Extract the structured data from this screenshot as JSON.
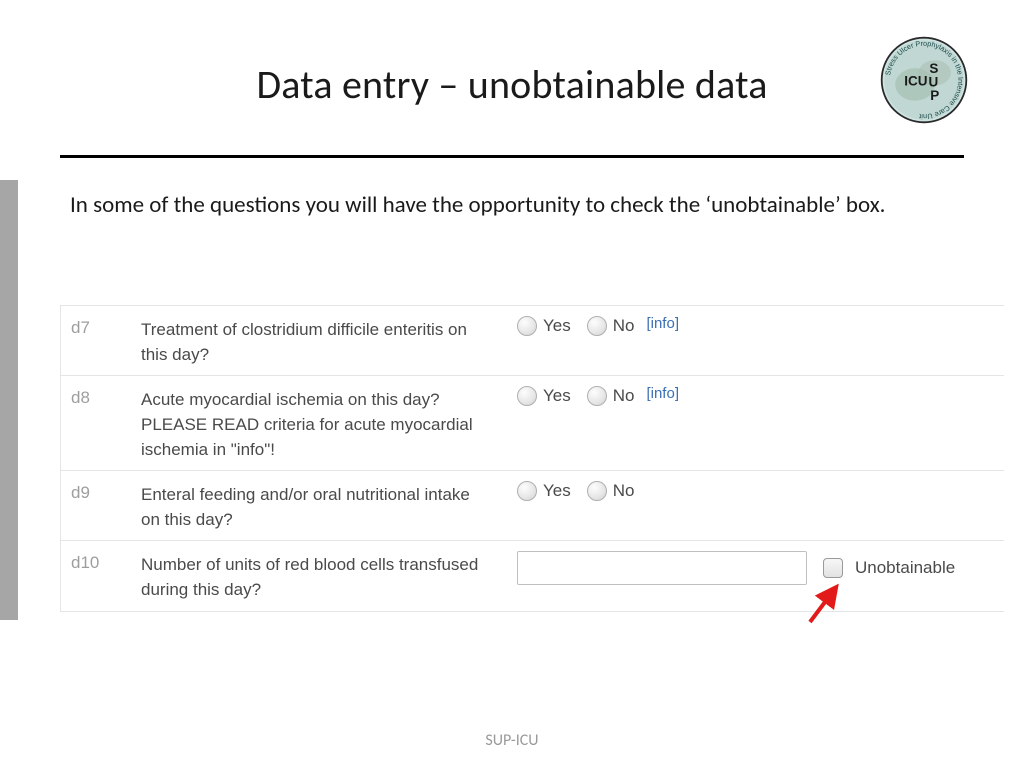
{
  "header": {
    "title": "Data entry – unobtainable data"
  },
  "intro": "In some of the questions you will have the opportunity to check the ‘unobtainable’ box.",
  "yes_label": "Yes",
  "no_label": "No",
  "info_label": "[info]",
  "unobtainable_label": "Unobtainable",
  "rows": {
    "d7": {
      "id": "d7",
      "question": "Treatment of clostridium difficile enteritis on this day?"
    },
    "d8": {
      "id": "d8",
      "question": "Acute myocardial ischemia on this day? PLEASE READ criteria for acute myocardial ischemia in \"info\"!"
    },
    "d9": {
      "id": "d9",
      "question": "Enteral feeding and/or oral nutritional intake on this day?"
    },
    "d10": {
      "id": "d10",
      "question": "Number of units of red blood cells transfused during this day?"
    }
  },
  "footer": "SUP-ICU",
  "logo": {
    "ring_text": "Stress Ulcer Prophylaxis in the Intensive Care Unit",
    "center_left": "ICU",
    "center_s": "S",
    "center_u": "U",
    "center_p": "P"
  }
}
